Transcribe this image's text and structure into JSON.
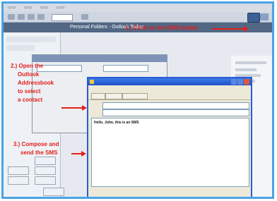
{
  "callouts": {
    "step1": "1.) Click on the SMS button",
    "step2_line1": "2.) Open the",
    "step2_line2": "Outlook",
    "step2_line3": "Addressbook",
    "step2_line4": "to select",
    "step2_line5": "a contact",
    "step3_line1": "3.) Compose and",
    "step3_line2": "send the SMS"
  },
  "outlook": {
    "navbar_title": "Personal Folders - Outlook Today"
  },
  "sms_window": {
    "message_text": "Hello, John, this is an SMS"
  },
  "colors": {
    "callout_red": "#e3201b",
    "frame_blue": "#4aa3e6",
    "sms_title_blue": "#1d52c9"
  }
}
